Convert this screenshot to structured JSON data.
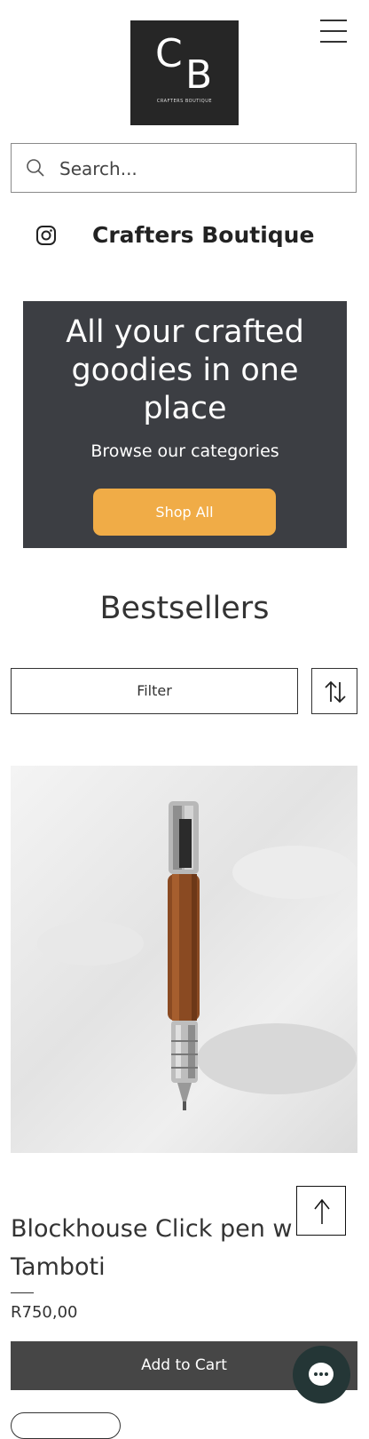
{
  "header": {
    "logo_letter_1": "C",
    "logo_letter_2": "B",
    "logo_subtitle": "CRAFTERS BOUTIQUE",
    "menu_icon": "hamburger-menu-icon"
  },
  "search": {
    "placeholder": "Search...",
    "icon": "search-icon"
  },
  "brand": {
    "instagram_icon": "instagram-icon",
    "name": "Crafters Boutique"
  },
  "hero": {
    "title": "All your crafted goodies in one place",
    "subtitle": "Browse our categories",
    "button_label": "Shop All",
    "background_color": "#3c3e43",
    "button_color": "#f0ac47"
  },
  "bestsellers": {
    "title": "Bestsellers",
    "filter_label": "Filter",
    "sort_icon": "sort-arrows-icon"
  },
  "product": {
    "name": "Blockhouse Click pen w Tamboti",
    "price": "R750,00",
    "add_to_cart_label": "Add to Cart"
  },
  "floating": {
    "back_to_top_icon": "arrow-up-icon",
    "chat_icon": "chat-bubble-icon",
    "chat_color": "#243636"
  }
}
